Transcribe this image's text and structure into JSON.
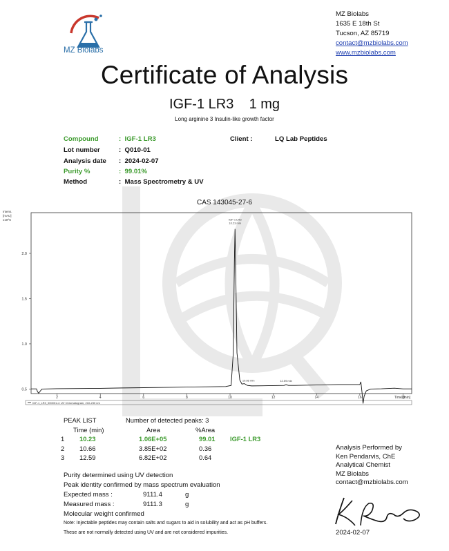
{
  "company": {
    "logo_text": "MZ Biolabs",
    "name": "MZ Biolabs",
    "address1": "1635 E 18th St",
    "address2": "Tucson, AZ 85719",
    "email": "contact@mzbiolabs.com",
    "website": "www.mzbiolabs.com"
  },
  "title": "Certificate of Analysis",
  "product": "IGF-1 LR3",
  "amount": "1 mg",
  "subtitle": "Long arginine 3 Insulin-like growth factor",
  "info": [
    {
      "label": "Compound",
      "value": "IGF-1 LR3",
      "highlight": true
    },
    {
      "label": "Lot number",
      "value": "Q010-01",
      "highlight": false
    },
    {
      "label": "Analysis date",
      "value": "2024-02-07",
      "highlight": false
    },
    {
      "label": "Purity %",
      "value": "99.01%",
      "highlight": true
    },
    {
      "label": "Method",
      "value": "Mass Spectrometry & UV",
      "highlight": false
    }
  ],
  "client_label": "Client :",
  "client_value": "LQ Lab Peptides",
  "cas": "CAS 143045-27-6",
  "chart_data": {
    "type": "line",
    "ylabel_lines": [
      "Intens.",
      "[mAU]",
      "x10^6"
    ],
    "yticks": [
      "2.0",
      "1.5",
      "1.0",
      "0.5"
    ],
    "ytick_values": [
      2.0,
      1.5,
      1.0,
      0.5
    ],
    "ylim": [
      0.45,
      2.45
    ],
    "xlim": [
      0.8,
      18.4
    ],
    "xticks": [
      "2",
      "4",
      "6",
      "8",
      "10",
      "12",
      "14",
      "16",
      "18"
    ],
    "xtick_values": [
      2,
      4,
      6,
      8,
      10,
      12,
      14,
      16,
      18
    ],
    "xlabel": "Time [min]",
    "legend": "IGF-1_LR3_000001.d: UV Chromatogram, 210-230 nm",
    "peak_label_main": [
      "IGF-1 LR3",
      "10.23 min"
    ],
    "peak_label_2": "10.66 min",
    "peak_label_3": "12.59 min",
    "x": [
      0.8,
      1.05,
      1.1,
      1.15,
      1.2,
      1.3,
      2.0,
      3.0,
      4.0,
      5.0,
      6.0,
      7.0,
      8.0,
      9.0,
      9.8,
      10.05,
      10.15,
      10.2,
      10.23,
      10.27,
      10.32,
      10.45,
      10.55,
      10.66,
      10.8,
      11.0,
      12.0,
      12.5,
      12.59,
      12.7,
      13.0,
      14.0,
      15.0,
      16.0,
      16.05,
      16.1,
      16.15,
      16.2,
      16.3,
      16.5,
      17.0,
      17.6,
      18.0,
      18.4
    ],
    "y": [
      0.502,
      0.502,
      0.47,
      0.455,
      0.47,
      0.5,
      0.504,
      0.506,
      0.508,
      0.512,
      0.515,
      0.518,
      0.522,
      0.525,
      0.528,
      0.54,
      0.9,
      1.9,
      2.27,
      1.7,
      0.9,
      0.6,
      0.555,
      0.56,
      0.54,
      0.535,
      0.538,
      0.54,
      0.548,
      0.54,
      0.54,
      0.545,
      0.55,
      0.55,
      0.58,
      0.47,
      0.34,
      0.42,
      0.48,
      0.5,
      0.503,
      0.51,
      0.502,
      0.502
    ]
  },
  "peak_list": {
    "title": "PEAK LIST",
    "count_label": "Number of detected peaks: 3",
    "headers": [
      "Time (min)",
      "Area",
      "%Area"
    ],
    "rows": [
      {
        "n": "1",
        "time": "10.23",
        "area": "1.06E+05",
        "pct": "99.01",
        "name": "IGF-1 LR3",
        "highlight": true
      },
      {
        "n": "2",
        "time": "10.66",
        "area": "3.85E+02",
        "pct": "0.36",
        "name": "",
        "highlight": false
      },
      {
        "n": "3",
        "time": "12.59",
        "area": "6.82E+02",
        "pct": "0.64",
        "name": "",
        "highlight": false
      }
    ]
  },
  "notes": {
    "purity_line": "Purity determined using UV detection",
    "identity_line": "Peak identity confirmed by mass spectrum evaluation",
    "expected_label": "Expected mass :",
    "expected_value": "9111.4",
    "measured_label": "Measured mass :",
    "measured_value": "9111.3",
    "unit": "g",
    "confirmed": "Molecular weight confirmed",
    "note1": "Note: Injectable peptides may contain salts and sugars to aid in solubility and act as pH buffers.",
    "note2": "These are not normally detected using UV and are not considered impurities."
  },
  "signature": {
    "line1": "Analysis Performed by",
    "line2": "Ken Pendarvis, ChE",
    "line3": "Analytical Chemist",
    "line4": "MZ Biolabs",
    "line5": "contact@mzbiolabs.com",
    "date": "2024-02-07"
  },
  "colors": {
    "green": "#3d9b2e",
    "logo_blue": "#2a6fa8",
    "logo_red": "#c9372c",
    "link": "#1f3fb0"
  }
}
